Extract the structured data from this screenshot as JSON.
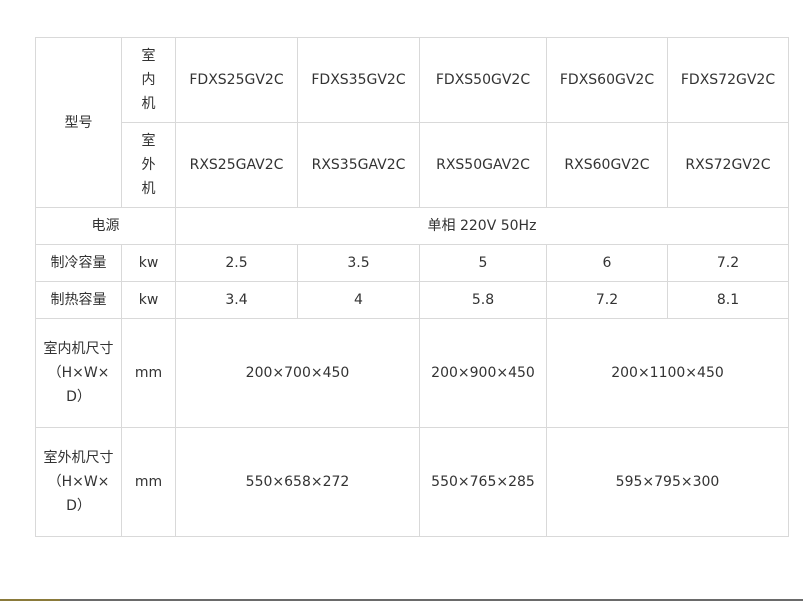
{
  "table": {
    "model_label": "型号",
    "indoor_label": "室内机",
    "outdoor_label": "室外机",
    "indoor_models": [
      "FDXS25GV2C",
      "FDXS35GV2C",
      "FDXS50GV2C",
      "FDXS60GV2C",
      "FDXS72GV2C"
    ],
    "outdoor_models": [
      "RXS25GAV2C",
      "RXS35GAV2C",
      "RXS50GAV2C",
      "RXS60GV2C",
      "RXS72GV2C"
    ],
    "power_label": "电源",
    "power_value": "单相 220V 50Hz",
    "cooling": {
      "label": "制冷容量",
      "unit": "kw",
      "values": [
        "2.5",
        "3.5",
        "5",
        "6",
        "7.2"
      ]
    },
    "heating": {
      "label": "制热容量",
      "unit": "kw",
      "values": [
        "3.4",
        "4",
        "5.8",
        "7.2",
        "8.1"
      ]
    },
    "indoor_size": {
      "label": "室内机尺寸（H×W×D）",
      "unit": "mm",
      "values": [
        "200×700×450",
        "200×900×450",
        "200×1100×450"
      ]
    },
    "outdoor_size": {
      "label": "室外机尺寸（H×W×D）",
      "unit": "mm",
      "values": [
        "550×658×272",
        "550×765×285",
        "595×795×300"
      ]
    }
  }
}
